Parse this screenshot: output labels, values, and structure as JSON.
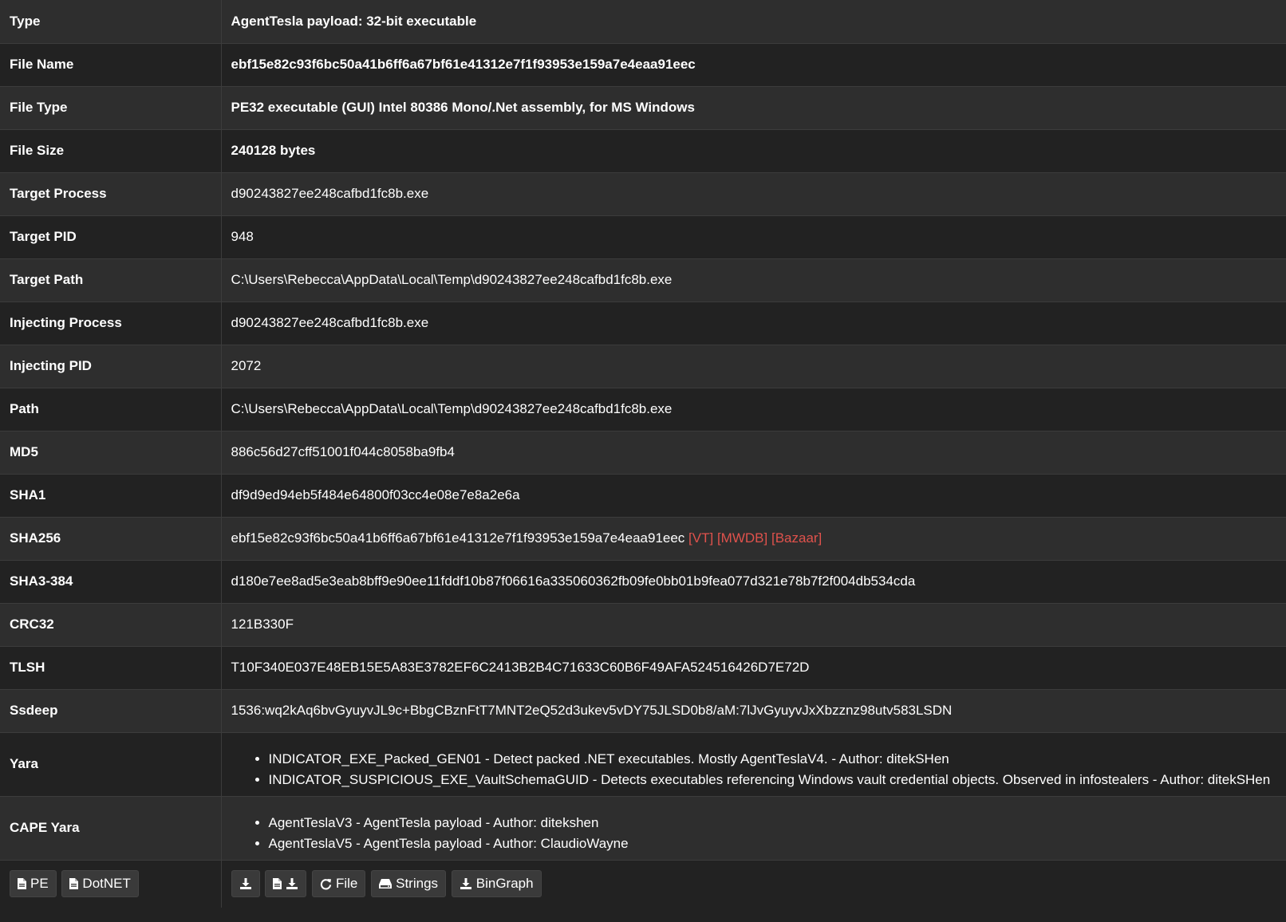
{
  "rows": [
    {
      "label": "Type",
      "value": "AgentTesla payload: 32-bit executable"
    },
    {
      "label": "File Name",
      "value": "ebf15e82c93f6bc50a41b6ff6a67bf61e41312e7f1f93953e159a7e4eaa91eec"
    },
    {
      "label": "File Type",
      "value": "PE32 executable (GUI) Intel 80386 Mono/.Net assembly, for MS Windows"
    },
    {
      "label": "File Size",
      "value": "240128 bytes"
    },
    {
      "label": "Target Process",
      "value": "d90243827ee248cafbd1fc8b.exe"
    },
    {
      "label": "Target PID",
      "value": "948"
    },
    {
      "label": "Target Path",
      "value": "C:\\Users\\Rebecca\\AppData\\Local\\Temp\\d90243827ee248cafbd1fc8b.exe"
    },
    {
      "label": "Injecting Process",
      "value": "d90243827ee248cafbd1fc8b.exe"
    },
    {
      "label": "Injecting PID",
      "value": "2072"
    },
    {
      "label": "Path",
      "value": "C:\\Users\\Rebecca\\AppData\\Local\\Temp\\d90243827ee248cafbd1fc8b.exe"
    },
    {
      "label": "MD5",
      "value": "886c56d27cff51001f044c8058ba9fb4"
    },
    {
      "label": "SHA1",
      "value": "df9d9ed94eb5f484e64800f03cc4e08e7e8a2e6a"
    },
    {
      "label": "SHA256",
      "value": "ebf15e82c93f6bc50a41b6ff6a67bf61e41312e7f1f93953e159a7e4eaa91eec",
      "links": [
        "[VT]",
        "[MWDB]",
        "[Bazaar]"
      ]
    },
    {
      "label": "SHA3-384",
      "value": "d180e7ee8ad5e3eab8bff9e90ee11fddf10b87f06616a335060362fb09fe0bb01b9fea077d321e78b7f2f004db534cda"
    },
    {
      "label": "CRC32",
      "value": "121B330F"
    },
    {
      "label": "TLSH",
      "value": "T10F340E037E48EB15E5A83E3782EF6C2413B2B4C71633C60B6F49AFA524516426D7E72D"
    },
    {
      "label": "Ssdeep",
      "value": "1536:wq2kAq6bvGyuyvJL9c+BbgCBznFtT7MNT2eQ52d3ukev5vDY75JLSD0b8/aM:7lJvGyuyvJxXbzznz98utv583LSDN"
    }
  ],
  "yara": {
    "label": "Yara",
    "items": [
      "INDICATOR_EXE_Packed_GEN01 - Detect packed .NET executables. Mostly AgentTeslaV4. - Author: ditekSHen",
      "INDICATOR_SUSPICIOUS_EXE_VaultSchemaGUID - Detects executables referencing Windows vault credential objects. Observed in infostealers - Author: ditekSHen"
    ]
  },
  "cape_yara": {
    "label": "CAPE Yara",
    "items": [
      "AgentTeslaV3 - AgentTesla payload - Author: ditekshen",
      "AgentTeslaV5 - AgentTesla payload - Author: ClaudioWayne"
    ]
  },
  "buttons_left": [
    {
      "label": "PE",
      "icon": "file-icon"
    },
    {
      "label": "DotNET",
      "icon": "file-icon"
    }
  ],
  "buttons_right": [
    {
      "label": "",
      "icon": "download-icon"
    },
    {
      "label": "",
      "icon": "file-download-icon"
    },
    {
      "label": "File",
      "icon": "refresh-icon"
    },
    {
      "label": "Strings",
      "icon": "hdd-icon"
    },
    {
      "label": "BinGraph",
      "icon": "download-icon"
    }
  ],
  "colors": {
    "row_odd": "#2e2e2e",
    "row_even": "#222222",
    "link": "#e0524c",
    "text": "#ffffff"
  }
}
